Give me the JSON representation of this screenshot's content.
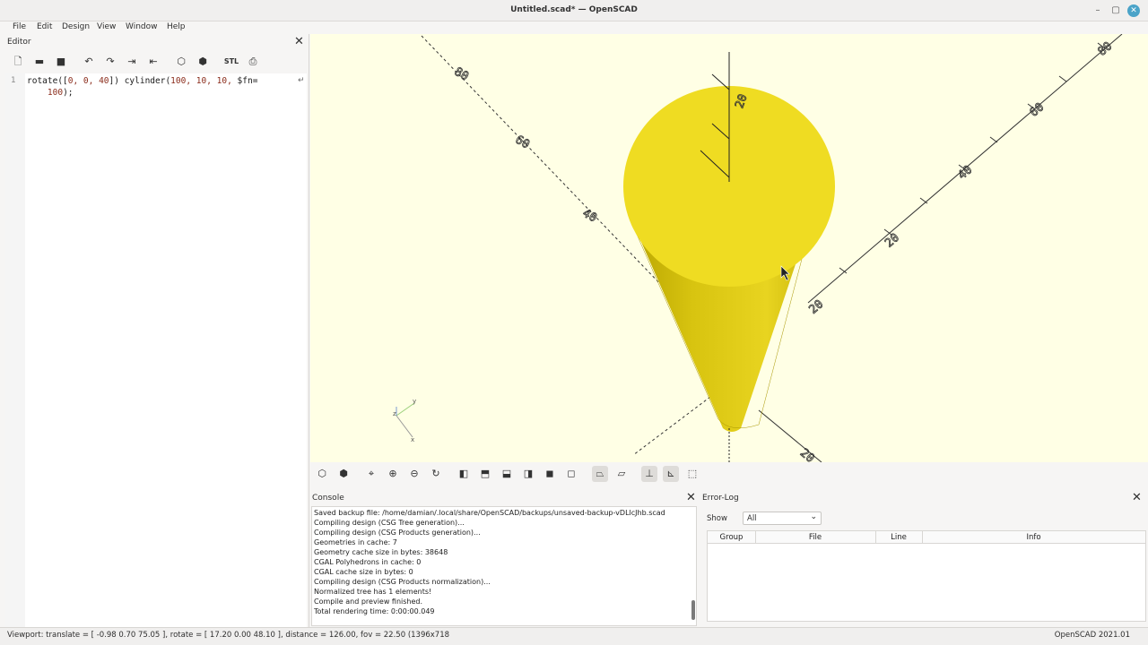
{
  "window": {
    "title": "Untitled.scad* — OpenSCAD"
  },
  "menu": [
    "File",
    "Edit",
    "Design",
    "View",
    "Window",
    "Help"
  ],
  "editor": {
    "title": "Editor",
    "line_number": "1",
    "code_line1_prefix": "rotate([",
    "code_line1_args": "0, 0, 40",
    "code_line1_mid": "]) cylinder(",
    "code_line1_nums": "100, 10, 10,",
    "code_line1_fn": " $fn=",
    "code_line2": "100",
    "code_line2_end": ");",
    "toolbar_icons": [
      "new-file-icon",
      "open-file-icon",
      "save-file-icon",
      "undo-icon",
      "redo-icon",
      "indent-icon",
      "unindent-icon",
      "preview-icon",
      "render-icon",
      "export-stl-icon",
      "send-to-printer-icon"
    ]
  },
  "viewport": {
    "model_color": "#f0e020",
    "background": "#ffffe5",
    "axis_labels": [
      "80",
      "60",
      "40",
      "20",
      "20",
      "40",
      "60",
      "80",
      "20",
      "20"
    ]
  },
  "view_toolbar": {
    "icons": [
      "preview-icon",
      "render-icon",
      "view-all-icon",
      "zoom-in-icon",
      "zoom-out-icon",
      "reset-view-icon",
      "view-right-icon",
      "view-top-icon",
      "view-bottom-icon",
      "view-left-icon",
      "view-front-icon",
      "view-back-icon",
      "perspective-icon",
      "orthogonal-icon",
      "show-axes-icon",
      "show-scale-markers-icon",
      "show-edges-icon"
    ]
  },
  "console": {
    "title": "Console",
    "lines": [
      "Saved backup file: /home/damian/.local/share/OpenSCAD/backups/unsaved-backup-vDLlcJhb.scad",
      "Compiling design (CSG Tree generation)...",
      "Compiling design (CSG Products generation)...",
      "Geometries in cache: 7",
      "Geometry cache size in bytes: 38648",
      "CGAL Polyhedrons in cache: 0",
      "CGAL cache size in bytes: 0",
      "Compiling design (CSG Products normalization)...",
      "Normalized tree has 1 elements!",
      "Compile and preview finished.",
      "Total rendering time: 0:00:00.049"
    ]
  },
  "error_log": {
    "title": "Error-Log",
    "show_label": "Show",
    "show_value": "All",
    "columns": [
      "Group",
      "File",
      "Line",
      "Info"
    ]
  },
  "status": {
    "viewport": "Viewport: translate = [ -0.98 0.70 75.05 ], rotate = [ 17.20 0.00 48.10 ], distance = 126.00, fov = 22.50 (1396x718",
    "version": "OpenSCAD 2021.01"
  }
}
